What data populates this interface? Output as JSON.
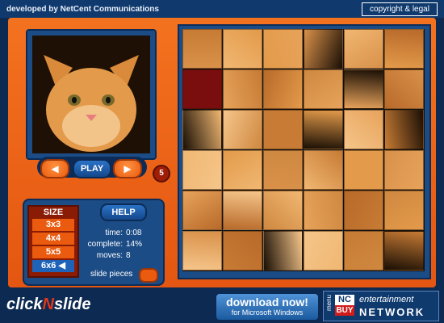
{
  "header": {
    "developer": "developed by NetCent Communications",
    "copyright": "copyright & legal"
  },
  "controls": {
    "prev_icon": "◀",
    "play_label": "PLAY",
    "next_icon": "▶",
    "counter": "5"
  },
  "size_panel": {
    "title": "SIZE",
    "options": [
      "3x3",
      "4x4",
      "5x5",
      "6x6"
    ],
    "selected": "6x6",
    "selected_marker": "◀"
  },
  "help_label": "HELP",
  "stats": {
    "time_label": "time:",
    "time": "0:08",
    "complete_label": "complete:",
    "complete": "14%",
    "moves_label": "moves:",
    "moves": "8"
  },
  "slide_pieces_label": "slide pieces",
  "footer": {
    "logo_click": "click",
    "logo_n": "N",
    "logo_slide": "slide",
    "download_title": "download now!",
    "download_sub": "for Microsoft Windows",
    "menu_label": "menu",
    "nc_top": "NC",
    "nc_bottom": "BUY",
    "entertainment": "entertainment",
    "network": "NETWORK"
  },
  "colors": {
    "orange": "#ea5b0f",
    "navy": "#0d2a52",
    "blue": "#1b4c86",
    "empty_tile": "#7a0e0e"
  }
}
